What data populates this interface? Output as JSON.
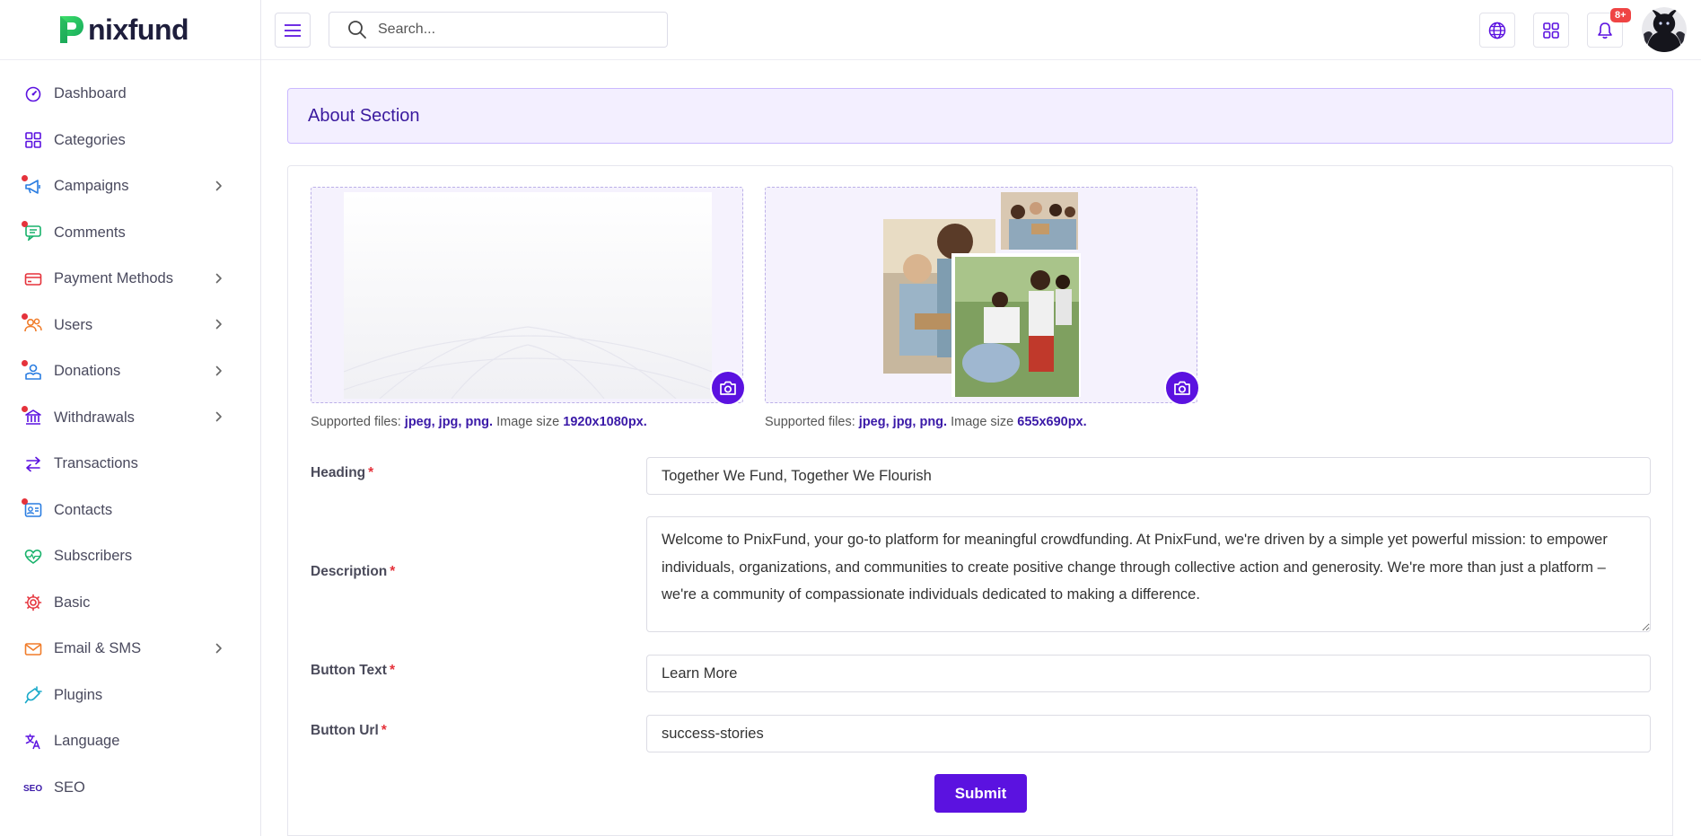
{
  "brand": {
    "name": "nixfund",
    "accent": "#5b12e0",
    "danger": "#ef4444"
  },
  "search": {
    "placeholder": "Search..."
  },
  "topbar": {
    "notification_count": "8+"
  },
  "sidebar": {
    "items": [
      {
        "label": "Dashboard",
        "icon": "gauge-icon",
        "has_chevron": false,
        "dot": false
      },
      {
        "label": "Categories",
        "icon": "grid-icon",
        "has_chevron": false,
        "dot": false
      },
      {
        "label": "Campaigns",
        "icon": "megaphone-icon",
        "has_chevron": true,
        "dot": true
      },
      {
        "label": "Comments",
        "icon": "comment-icon",
        "has_chevron": false,
        "dot": true
      },
      {
        "label": "Payment Methods",
        "icon": "credit-card-icon",
        "has_chevron": true,
        "dot": false
      },
      {
        "label": "Users",
        "icon": "users-icon",
        "has_chevron": true,
        "dot": true
      },
      {
        "label": "Donations",
        "icon": "donation-icon",
        "has_chevron": true,
        "dot": true
      },
      {
        "label": "Withdrawals",
        "icon": "bank-icon",
        "has_chevron": true,
        "dot": true
      },
      {
        "label": "Transactions",
        "icon": "transfer-icon",
        "has_chevron": false,
        "dot": false
      },
      {
        "label": "Contacts",
        "icon": "contact-card-icon",
        "has_chevron": false,
        "dot": true
      },
      {
        "label": "Subscribers",
        "icon": "heart-icon",
        "has_chevron": false,
        "dot": false
      },
      {
        "label": "Basic",
        "icon": "settings-icon",
        "has_chevron": false,
        "dot": false
      },
      {
        "label": "Email & SMS",
        "icon": "envelope-icon",
        "has_chevron": true,
        "dot": false
      },
      {
        "label": "Plugins",
        "icon": "plug-icon",
        "has_chevron": false,
        "dot": false
      },
      {
        "label": "Language",
        "icon": "translate-icon",
        "has_chevron": false,
        "dot": false
      },
      {
        "label": "SEO",
        "icon": "seo-icon",
        "has_chevron": false,
        "dot": false
      }
    ]
  },
  "main": {
    "section_title": "About Section",
    "upload1": {
      "hint_prefix": "Supported files:",
      "hint_types": "jpeg, jpg, png.",
      "hint_size_label": "Image size",
      "hint_size": "1920x1080px."
    },
    "upload2": {
      "hint_prefix": "Supported files:",
      "hint_types": "jpeg, jpg, png.",
      "hint_size_label": "Image size",
      "hint_size": "655x690px."
    },
    "form": {
      "heading_label": "Heading",
      "heading_value": "Together We Fund, Together We Flourish",
      "description_label": "Description",
      "description_value": "Welcome to PnixFund, your go-to platform for meaningful crowdfunding. At PnixFund, we're driven by a simple yet powerful mission: to empower individuals, organizations, and communities to create positive change through collective action and generosity. We're more than just a platform – we're a community of compassionate individuals dedicated to making a difference.",
      "button_text_label": "Button Text",
      "button_text_value": "Learn More",
      "button_url_label": "Button Url",
      "button_url_value": "success-stories",
      "required_marker": "*",
      "submit_label": "Submit"
    }
  }
}
